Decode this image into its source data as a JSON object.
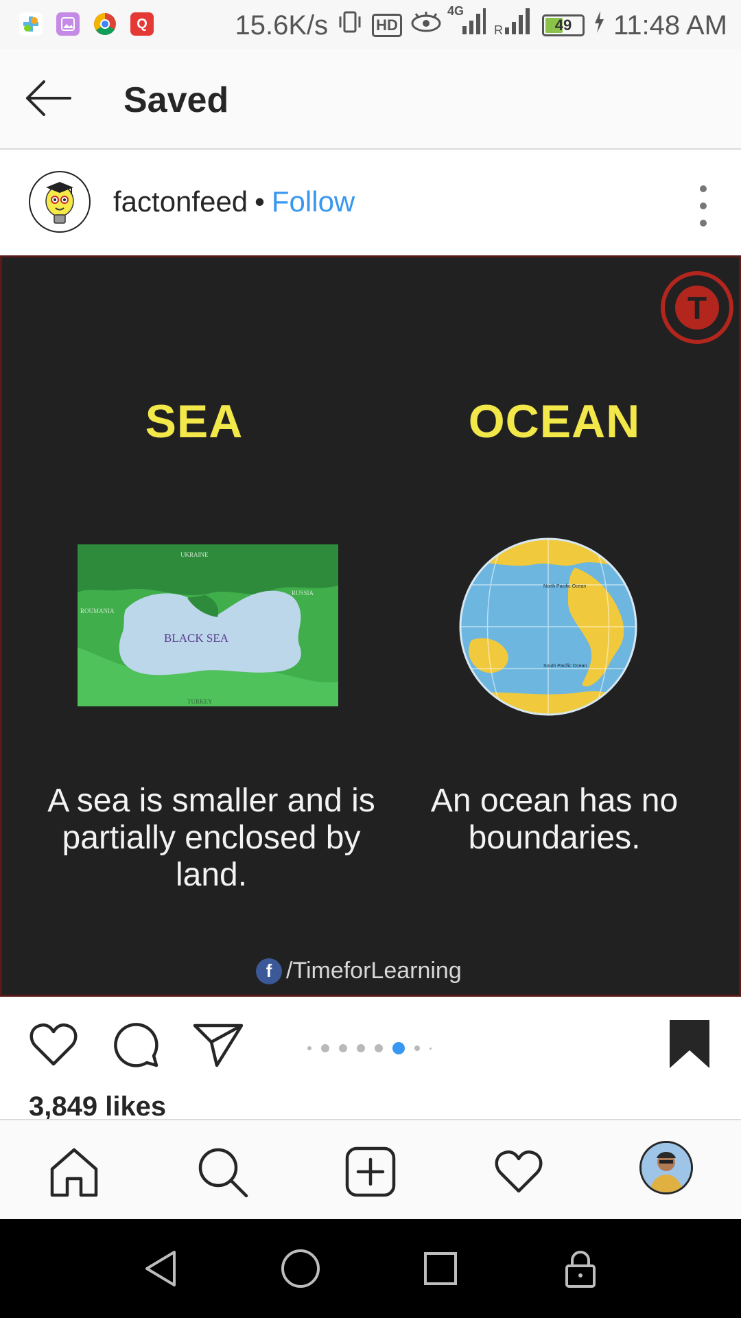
{
  "status_bar": {
    "network_speed": "15.6K/s",
    "hd_badge": "HD",
    "network_type": "4G",
    "battery_level": "49",
    "time": "11:48 AM",
    "icons": [
      "game-app-icon",
      "gallery-app-icon",
      "chrome-app-icon",
      "q-app-icon",
      "vibrate-icon",
      "eye-icon",
      "signal-icon",
      "signal-icon",
      "battery-icon",
      "charging-icon"
    ]
  },
  "header": {
    "title": "Saved"
  },
  "post": {
    "username": "factonfeed",
    "separator": "•",
    "follow_label": "Follow",
    "image": {
      "sea_heading": "SEA",
      "ocean_heading": "OCEAN",
      "sea_caption": "A sea is smaller and is partially enclosed by land.",
      "ocean_caption": "An ocean has no boundaries.",
      "credit": "/TimeforLearning",
      "credit_fb": "f",
      "logo_letter": "T",
      "map_labels": {
        "black_sea": "BLACK SEA",
        "ukraine": "UKRAINE",
        "roumania": "ROUMANIA",
        "russia": "RUSSIA",
        "turkey": "TURKEY"
      },
      "globe_labels": {
        "north_pacific": "North Pacific Ocean",
        "south_pacific": "South Pacific Ocean"
      }
    },
    "carousel": {
      "active_index": 5,
      "dot_count": 8
    },
    "likes": "3,849 likes"
  },
  "colors": {
    "accent": "#3897f0",
    "heading_yellow": "#f2e84a",
    "image_bg": "#212121"
  }
}
